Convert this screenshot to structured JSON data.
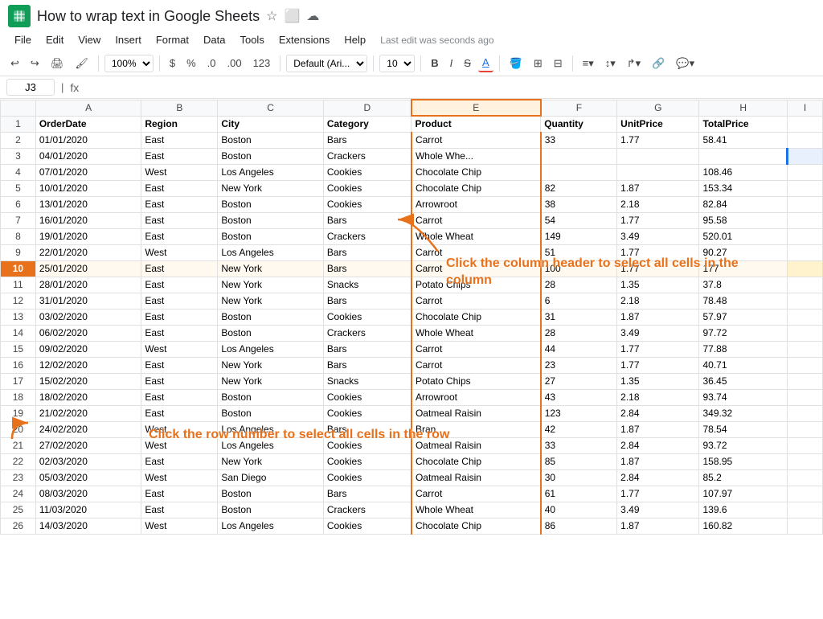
{
  "title": "How to wrap text in Google Sheets",
  "app": {
    "icon": "Σ",
    "menu": [
      "File",
      "Edit",
      "View",
      "Insert",
      "Format",
      "Data",
      "Tools",
      "Extensions",
      "Help"
    ],
    "last_edit": "Last edit was seconds ago"
  },
  "toolbar": {
    "zoom": "100%",
    "currency": "$",
    "percent": "%",
    "decimal0": ".0",
    "decimal00": ".00",
    "number123": "123",
    "font": "Default (Ari...",
    "font_size": "10",
    "bold": "B",
    "italic": "I",
    "strikethrough": "S",
    "underline": "A"
  },
  "formula_bar": {
    "cell_ref": "J3",
    "formula_icon": "fx"
  },
  "columns": [
    "",
    "A",
    "B",
    "C",
    "D",
    "E",
    "F",
    "G",
    "H",
    "I"
  ],
  "col_headers": [
    "OrderDate",
    "Region",
    "City",
    "Category",
    "Product",
    "Quantity",
    "UnitPrice",
    "TotalPrice"
  ],
  "rows": [
    [
      "01/01/2020",
      "East",
      "Boston",
      "Bars",
      "Carrot",
      "33",
      "1.77",
      "58.41"
    ],
    [
      "04/01/2020",
      "East",
      "Boston",
      "Crackers",
      "Whole Whe...",
      "",
      "",
      ""
    ],
    [
      "07/01/2020",
      "West",
      "Los Angeles",
      "Cookies",
      "Chocolate Chip",
      "",
      "",
      "108.46"
    ],
    [
      "10/01/2020",
      "East",
      "New York",
      "Cookies",
      "Chocolate Chip",
      "82",
      "1.87",
      "153.34"
    ],
    [
      "13/01/2020",
      "East",
      "Boston",
      "Cookies",
      "Arrowroot",
      "38",
      "2.18",
      "82.84"
    ],
    [
      "16/01/2020",
      "East",
      "Boston",
      "Bars",
      "Carrot",
      "54",
      "1.77",
      "95.58"
    ],
    [
      "19/01/2020",
      "East",
      "Boston",
      "Crackers",
      "Whole Wheat",
      "149",
      "3.49",
      "520.01"
    ],
    [
      "22/01/2020",
      "West",
      "Los Angeles",
      "Bars",
      "Carrot",
      "51",
      "1.77",
      "90.27"
    ],
    [
      "25/01/2020",
      "East",
      "New York",
      "Bars",
      "Carrot",
      "100",
      "1.77",
      "177"
    ],
    [
      "28/01/2020",
      "East",
      "New York",
      "Snacks",
      "Potato Chips",
      "28",
      "1.35",
      "37.8"
    ],
    [
      "31/01/2020",
      "East",
      "New York",
      "Bars",
      "Carrot",
      "6",
      "2.18",
      "78.48"
    ],
    [
      "03/02/2020",
      "East",
      "Boston",
      "Cookies",
      "Chocolate Chip",
      "31",
      "1.87",
      "57.97"
    ],
    [
      "06/02/2020",
      "East",
      "Boston",
      "Crackers",
      "Whole Wheat",
      "28",
      "3.49",
      "97.72"
    ],
    [
      "09/02/2020",
      "West",
      "Los Angeles",
      "Bars",
      "Carrot",
      "44",
      "1.77",
      "77.88"
    ],
    [
      "12/02/2020",
      "East",
      "New York",
      "Bars",
      "Carrot",
      "23",
      "1.77",
      "40.71"
    ],
    [
      "15/02/2020",
      "East",
      "New York",
      "Snacks",
      "Potato Chips",
      "27",
      "1.35",
      "36.45"
    ],
    [
      "18/02/2020",
      "East",
      "Boston",
      "Cookies",
      "Arrowroot",
      "43",
      "2.18",
      "93.74"
    ],
    [
      "21/02/2020",
      "East",
      "Boston",
      "Cookies",
      "Oatmeal Raisin",
      "123",
      "2.84",
      "349.32"
    ],
    [
      "24/02/2020",
      "West",
      "Los Angeles",
      "Bars",
      "Bran",
      "42",
      "1.87",
      "78.54"
    ],
    [
      "27/02/2020",
      "West",
      "Los Angeles",
      "Cookies",
      "Oatmeal Raisin",
      "33",
      "2.84",
      "93.72"
    ],
    [
      "02/03/2020",
      "East",
      "New York",
      "Cookies",
      "Chocolate Chip",
      "85",
      "1.87",
      "158.95"
    ],
    [
      "05/03/2020",
      "West",
      "San Diego",
      "Cookies",
      "Oatmeal Raisin",
      "30",
      "2.84",
      "85.2"
    ],
    [
      "08/03/2020",
      "East",
      "Boston",
      "Bars",
      "Carrot",
      "61",
      "1.77",
      "107.97"
    ],
    [
      "11/03/2020",
      "East",
      "Boston",
      "Crackers",
      "Whole Wheat",
      "40",
      "3.49",
      "139.6"
    ],
    [
      "14/03/2020",
      "West",
      "Los Angeles",
      "Cookies",
      "Chocolate Chip",
      "86",
      "1.87",
      "160.82"
    ]
  ],
  "annotations": {
    "col_text": "Click the column header to select all cells in the column",
    "row_text": "Click the row number to select all cells in the row"
  }
}
